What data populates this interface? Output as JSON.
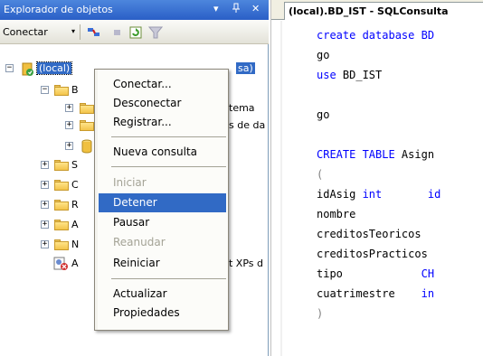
{
  "object_explorer": {
    "title": "Explorador de objetos",
    "title_controls": {
      "dropdown": "▾",
      "pin": "ᵖ",
      "close": "✕"
    },
    "toolbar": {
      "connect_label": "Conectar",
      "connect_arrow": "▾"
    },
    "tree": {
      "server_label": "(local)",
      "server_suffix": "sa)",
      "node_b": "B",
      "node_tema": "tema",
      "node_de_da": "s de da",
      "node_s": "S",
      "node_c": "C",
      "node_r": "R",
      "node_a": "A",
      "node_n": "N",
      "node_a2": "A",
      "node_xps": "t XPs d"
    }
  },
  "editor": {
    "tab_title": "(local).BD_IST - SQLConsulta",
    "lines": [
      {
        "parts": [
          {
            "t": "create database BD",
            "c": "kw"
          }
        ]
      },
      {
        "parts": [
          {
            "t": "go",
            "c": "id"
          }
        ]
      },
      {
        "parts": [
          {
            "t": "use ",
            "c": "kw"
          },
          {
            "t": "BD_IST",
            "c": "id"
          }
        ]
      },
      {
        "parts": [
          {
            "t": "",
            "c": "id"
          }
        ]
      },
      {
        "parts": [
          {
            "t": "go",
            "c": "id"
          }
        ]
      },
      {
        "parts": [
          {
            "t": "",
            "c": "id"
          }
        ]
      },
      {
        "parts": [
          {
            "t": "CREATE TABLE ",
            "c": "kw"
          },
          {
            "t": "Asign",
            "c": "id"
          }
        ]
      },
      {
        "parts": [
          {
            "t": "(",
            "c": "gr"
          }
        ]
      },
      {
        "parts": [
          {
            "t": "idAsig ",
            "c": "id"
          },
          {
            "t": "int",
            "c": "kw"
          },
          {
            "t": "       ",
            "c": "id"
          },
          {
            "t": "id",
            "c": "kw"
          }
        ]
      },
      {
        "parts": [
          {
            "t": "nombre",
            "c": "id"
          }
        ]
      },
      {
        "parts": [
          {
            "t": "creditosTeoricos",
            "c": "id"
          }
        ]
      },
      {
        "parts": [
          {
            "t": "creditosPracticos",
            "c": "id"
          }
        ]
      },
      {
        "parts": [
          {
            "t": "tipo",
            "c": "id"
          },
          {
            "t": "            ",
            "c": "id"
          },
          {
            "t": "CH",
            "c": "kw"
          }
        ]
      },
      {
        "parts": [
          {
            "t": "cuatrimestre",
            "c": "id"
          },
          {
            "t": "    ",
            "c": "id"
          },
          {
            "t": "in",
            "c": "kw"
          }
        ]
      },
      {
        "parts": [
          {
            "t": ")",
            "c": "gr"
          }
        ]
      }
    ]
  },
  "context_menu": {
    "items": [
      {
        "label": "Conectar...",
        "state": "normal"
      },
      {
        "label": "Desconectar",
        "state": "normal"
      },
      {
        "label": "Registrar...",
        "state": "normal"
      },
      {
        "label": "Nueva consulta",
        "state": "normal"
      },
      {
        "label": "Iniciar",
        "state": "disabled"
      },
      {
        "label": "Detener",
        "state": "selected"
      },
      {
        "label": "Pausar",
        "state": "normal"
      },
      {
        "label": "Reanudar",
        "state": "disabled"
      },
      {
        "label": "Reiniciar",
        "state": "normal"
      },
      {
        "label": "Actualizar",
        "state": "normal"
      },
      {
        "label": "Propiedades",
        "state": "normal"
      }
    ]
  },
  "colors": {
    "title_bar": "#2a5fc7",
    "selection": "#316ac5",
    "keyword": "#0000ff",
    "folder": "#f3c44b"
  }
}
